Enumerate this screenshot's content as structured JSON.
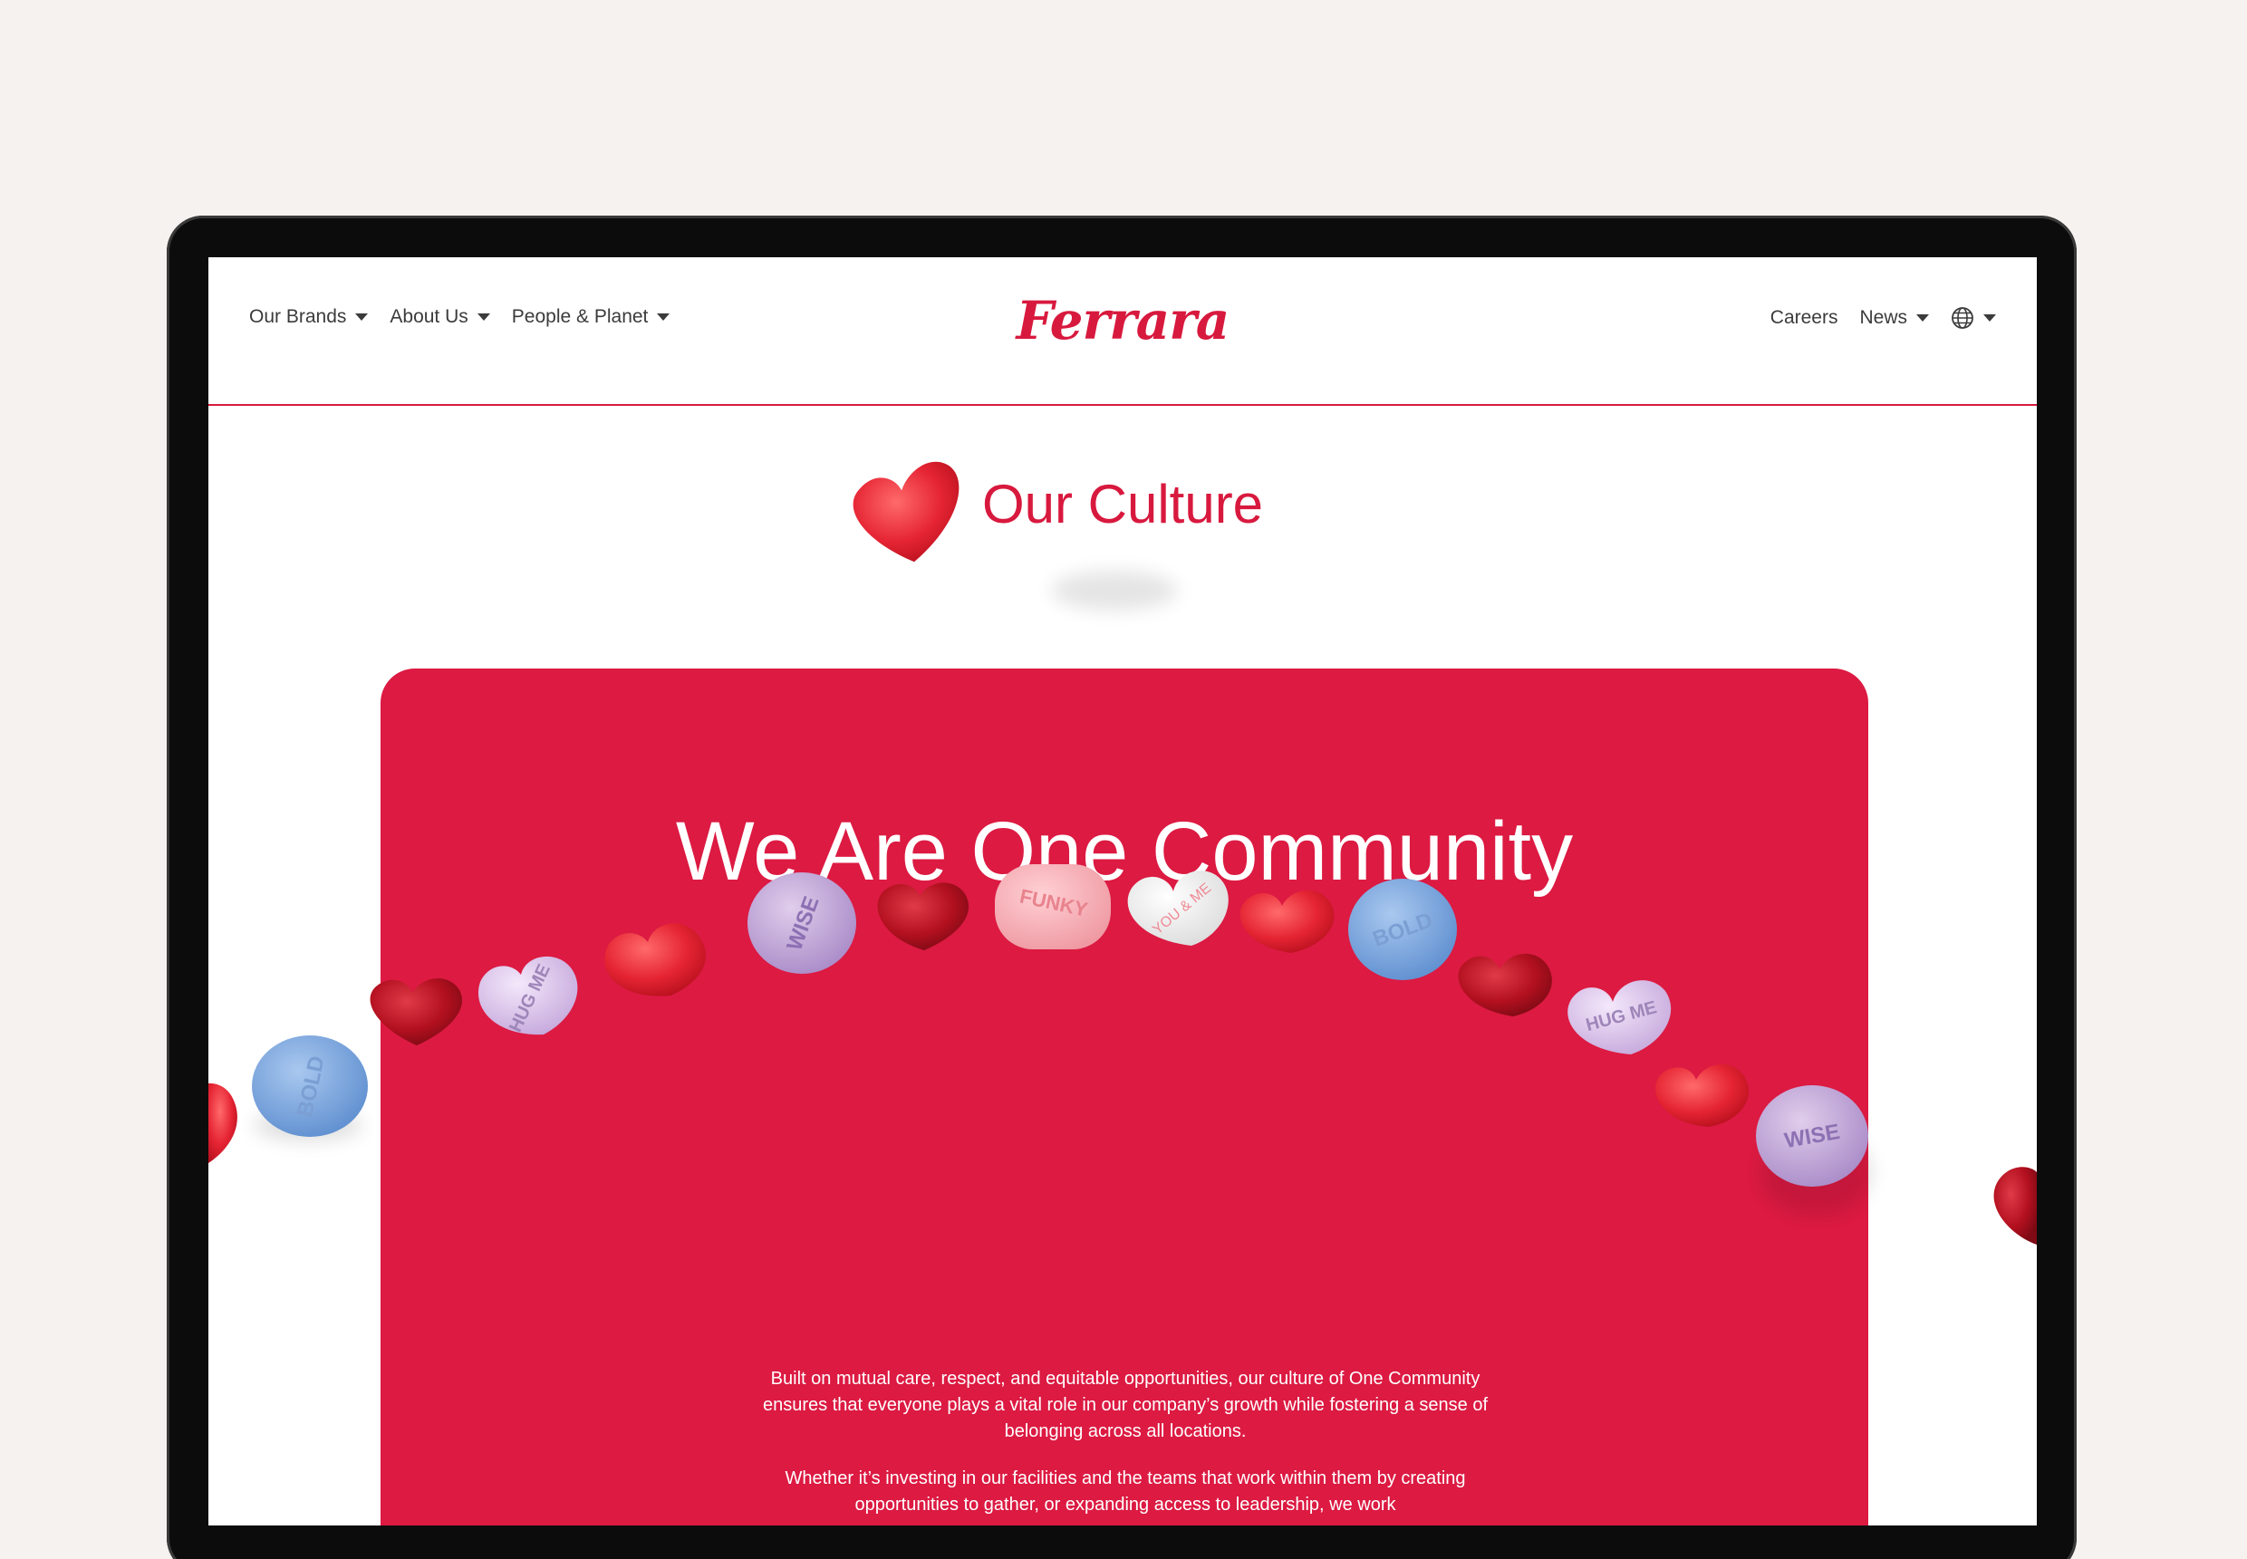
{
  "nav": {
    "left": [
      {
        "label": "Our Brands"
      },
      {
        "label": "About Us"
      },
      {
        "label": "People & Planet"
      }
    ],
    "right": [
      {
        "label": "Careers"
      },
      {
        "label": "News"
      }
    ],
    "logo_text": "Ferrara"
  },
  "page": {
    "title": "Our Culture"
  },
  "hero": {
    "title": "We Are One Community",
    "paragraph1": "Built on mutual care, respect, and equitable opportunities, our culture of One Community ensures that everyone plays a vital role in our company’s growth while fostering a sense of belonging across all locations.",
    "paragraph2": "Whether it’s investing in our facilities and the teams that work within them by creating opportunities to gather, or expanding access to leadership, we work"
  },
  "candies": {
    "labels": [
      "BOLD",
      "HUG ME",
      "WISE",
      "FUNKY",
      "YOU & ME",
      "BOLD",
      "HUG ME",
      "WISE"
    ]
  },
  "colors": {
    "brand_red": "#dc1a42",
    "nav_text": "#3b3b3b",
    "background": "#f6f2ef"
  }
}
